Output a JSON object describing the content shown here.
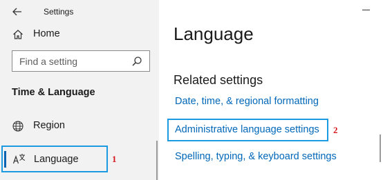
{
  "window": {
    "app_title": "Settings"
  },
  "sidebar": {
    "back_icon": "arrow-left-icon",
    "home": {
      "label": "Home",
      "icon": "home-icon"
    },
    "search": {
      "placeholder": "Find a setting",
      "value": "",
      "icon": "search-icon"
    },
    "section_heading": "Time & Language",
    "items": [
      {
        "label": "Region",
        "icon": "globe-icon",
        "selected": false
      },
      {
        "label": "Language",
        "icon": "language-icon",
        "selected": true
      }
    ],
    "marker": "1"
  },
  "main": {
    "title": "Language",
    "related_heading": "Related settings",
    "links": [
      {
        "label": "Date, time, & regional formatting"
      },
      {
        "label": "Administrative language settings",
        "highlighted": true
      },
      {
        "label": "Spelling, typing, & keyboard settings"
      }
    ],
    "marker": "2"
  },
  "colors": {
    "sidebar_bg": "#f2f2f2",
    "link": "#0067b8",
    "highlight_border": "#1b9ae2",
    "selection_accent": "#0063b1",
    "marker": "#d6151d"
  }
}
